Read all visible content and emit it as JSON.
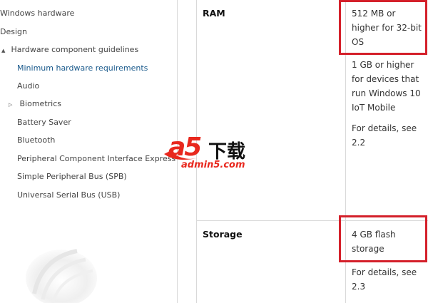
{
  "sidebar": {
    "items": [
      {
        "label": "Windows hardware"
      },
      {
        "label": "Design"
      },
      {
        "label": "Hardware component guidelines",
        "caret": "▲"
      },
      {
        "label": "Minimum hardware requirements"
      },
      {
        "label": "Audio"
      },
      {
        "label": "Biometrics",
        "caret": "▷"
      },
      {
        "label": "Battery Saver"
      },
      {
        "label": "Bluetooth"
      },
      {
        "label": "Peripheral Component Interface Express"
      },
      {
        "label": "Simple Peripheral Bus (SPB)"
      },
      {
        "label": "Universal Serial Bus (USB)"
      }
    ]
  },
  "table": {
    "rows": [
      {
        "label": "RAM",
        "values": [
          "512 MB or higher for 32-bit OS",
          "1 GB or higher for devices that run Windows 10 IoT Mobile",
          "For details, see 2.2"
        ]
      },
      {
        "label": "Storage",
        "values": [
          "4 GB flash storage",
          "For details, see 2.3"
        ]
      }
    ]
  },
  "watermark": {
    "brand": "a5",
    "chinese": "下载",
    "domain": "admin5.com"
  },
  "colors": {
    "highlight": "#d4202a",
    "active_link": "#1a5a8c",
    "brand_red": "#e8281e"
  }
}
